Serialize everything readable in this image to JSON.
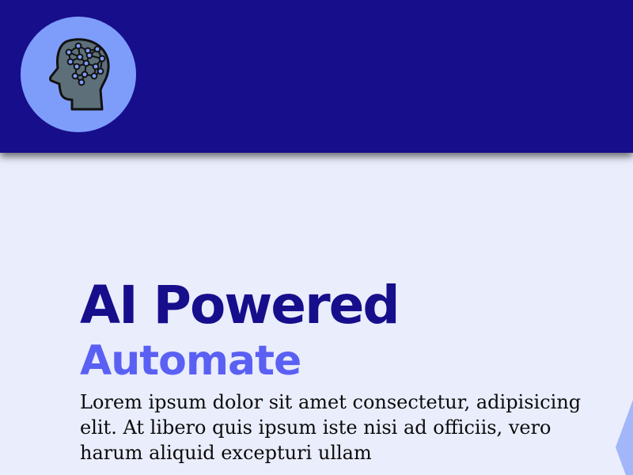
{
  "header": {
    "logo_icon": "ai-brain-head-icon",
    "background_color": "#170e8c",
    "logo_circle_color": "#7e9dfb"
  },
  "hero": {
    "title": "AI Powered",
    "subtitle": "Automate",
    "body": "Lorem ipsum dolor sit amet consectetur, adipisicing elit. At libero quis ipsum iste nisi ad officiis, vero harum aliquid excepturi ullam",
    "title_color": "#170e8c",
    "subtitle_color": "#5a60f3"
  },
  "page": {
    "background_color": "#eaedfc"
  }
}
